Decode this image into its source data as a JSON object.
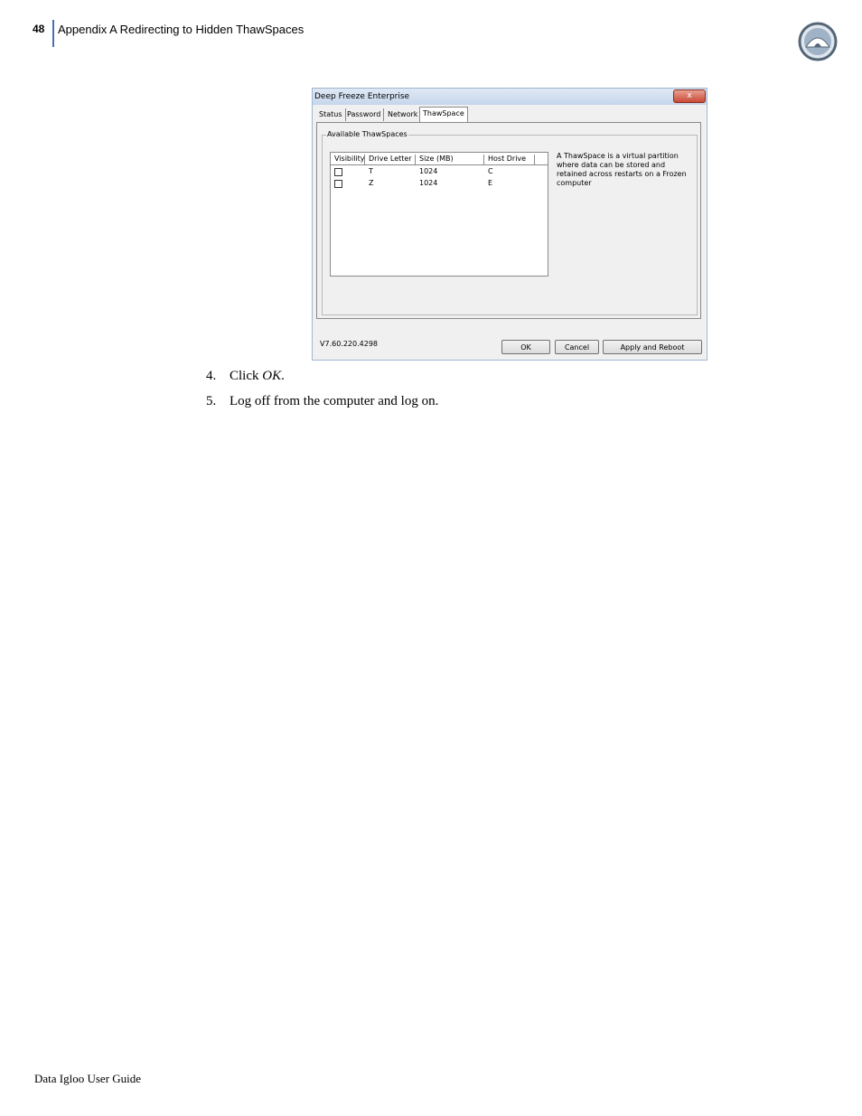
{
  "header": {
    "page_number": "48",
    "title": "Appendix A  Redirecting to Hidden ThawSpaces",
    "logo_icon": "igloo-logo-icon"
  },
  "dialog": {
    "title": "Deep Freeze Enterprise",
    "close_label": "x",
    "tabs": [
      {
        "label": "Status"
      },
      {
        "label": "Password"
      },
      {
        "label": "Network"
      },
      {
        "label": "ThawSpace"
      }
    ],
    "group_label": "Available ThawSpaces",
    "columns": [
      "Visibility",
      "Drive Letter",
      "Size (MB)",
      "Host Drive"
    ],
    "rows": [
      {
        "visible": false,
        "drive": "T",
        "size": "1024",
        "host": "C"
      },
      {
        "visible": false,
        "drive": "Z",
        "size": "1024",
        "host": "E"
      }
    ],
    "description": "A ThawSpace is a virtual partition where data can be stored and retained across restarts on a Frozen computer",
    "version": "V7.60.220.4298",
    "buttons": {
      "ok": "OK",
      "cancel": "Cancel",
      "apply": "Apply and Reboot"
    }
  },
  "steps": [
    {
      "num": "4.",
      "text_before": "Click ",
      "emph": "OK",
      "text_after": "."
    },
    {
      "num": "5.",
      "text_before": "Log off from the computer and log on.",
      "emph": "",
      "text_after": ""
    }
  ],
  "footer": "Data Igloo User Guide"
}
